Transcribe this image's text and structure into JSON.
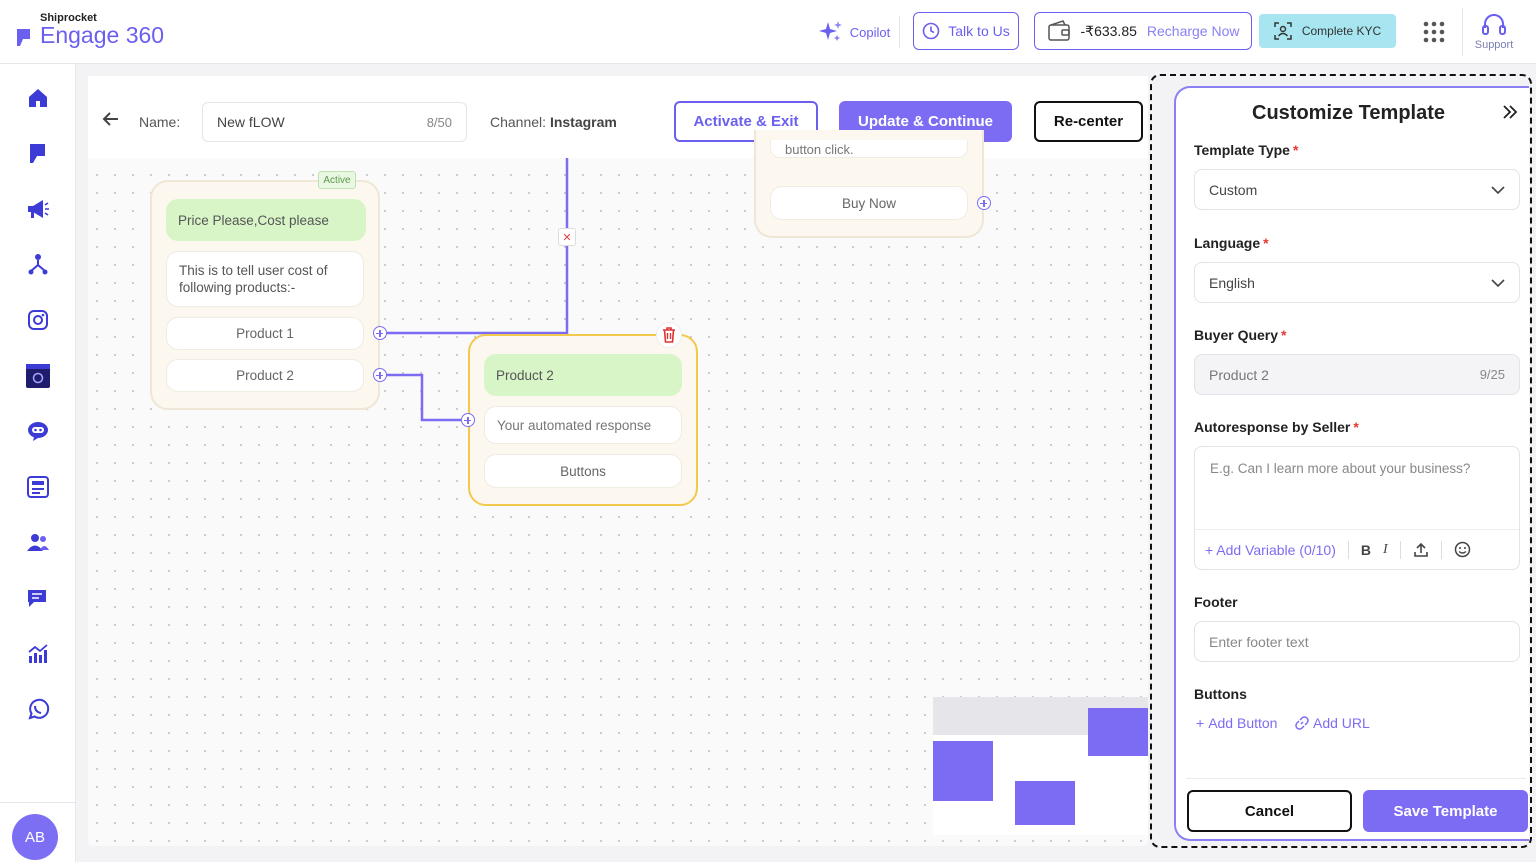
{
  "header": {
    "brand_small": "Shiprocket",
    "brand_name": "Engage 360",
    "copilot_label": "Copilot",
    "talk_label": "Talk to Us",
    "wallet_amount": "-₹633.85",
    "recharge_label": "Recharge Now",
    "kyc_label": "Complete KYC",
    "support_label": "Support"
  },
  "sidebar": {
    "icons": [
      "home-icon",
      "engage-logo-icon",
      "megaphone-icon",
      "flow-branch-icon",
      "instagram-icon",
      "calendar-icon",
      "chat-bot-icon",
      "templates-icon",
      "users-icon",
      "messages-icon",
      "analytics-icon",
      "whatsapp-icon"
    ],
    "avatar_initials": "AB"
  },
  "flowbar": {
    "name_label": "Name:",
    "name_value": "New fLOW",
    "name_count": "8/50",
    "channel_label": "Channel:",
    "channel_value": "Instagram",
    "activate_label": "Activate & Exit",
    "update_label": "Update & Continue",
    "recenter_label": "Re-center"
  },
  "nodes": {
    "node1": {
      "badge": "Active",
      "query": "Price Please,Cost please",
      "response": "This is to tell user cost of following products:-",
      "buttons": [
        "Product 1",
        "Product 2"
      ]
    },
    "node2": {
      "query": "Product 2",
      "response": "Your automated response",
      "buttons_label": "Buttons"
    },
    "node3": {
      "partial_text": "button click.",
      "button": "Buy Now"
    }
  },
  "panel": {
    "title": "Customize Template",
    "template_type_label": "Template Type",
    "template_type_value": "Custom",
    "language_label": "Language",
    "language_value": "English",
    "buyer_query_label": "Buyer Query",
    "buyer_query_value": "Product 2",
    "buyer_query_count": "9/25",
    "autoresponse_label": "Autoresponse by Seller",
    "autoresponse_placeholder": "E.g. Can I learn more about your business?",
    "add_variable_label": "Add Variable (0/10)",
    "footer_label": "Footer",
    "footer_placeholder": "Enter footer text",
    "buttons_label": "Buttons",
    "add_button_label": "Add Button",
    "add_url_label": "Add URL",
    "cancel_label": "Cancel",
    "save_label": "Save Template"
  },
  "colors": {
    "accent": "#7c6cf3",
    "kyc_bg": "#a7e6f0",
    "node_bg": "#fdf8ef",
    "query_bg": "#d8f5c8",
    "selected_border": "#f2c94c"
  }
}
